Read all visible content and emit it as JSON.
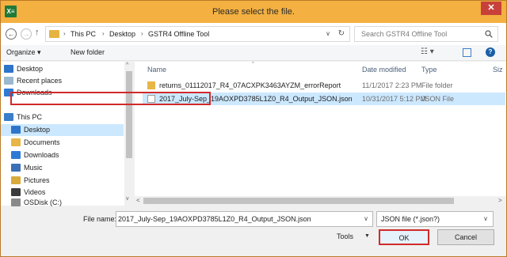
{
  "window": {
    "title": "Please select the file.",
    "app_icon": "X≡",
    "close_symbol": "✕"
  },
  "address_bar": {
    "back_symbol": "←",
    "forward_symbol": "→",
    "up_symbol": "↑",
    "breadcrumb": [
      "This PC",
      "Desktop",
      "GSTR4 Offline Tool"
    ],
    "separator": "›",
    "dropdown_symbol": "∨",
    "refresh_symbol": "↻",
    "search_placeholder": "Search GSTR4 Offline Tool"
  },
  "toolbar": {
    "organize_label": "Organize ▾",
    "new_folder_label": "New folder",
    "view_symbol": "☷ ▾",
    "help_symbol": "?"
  },
  "nav_pane": {
    "items": [
      {
        "label": "Desktop",
        "icon": "desktop-icon"
      },
      {
        "label": "Recent places",
        "icon": "recent-places-icon"
      },
      {
        "label": "Downloads",
        "icon": "downloads-icon"
      },
      {
        "label": "This PC",
        "icon": "computer-icon"
      },
      {
        "label": "Desktop",
        "icon": "desktop-folder-icon"
      },
      {
        "label": "Documents",
        "icon": "documents-folder-icon"
      },
      {
        "label": "Downloads",
        "icon": "downloads-folder-icon"
      },
      {
        "label": "Music",
        "icon": "music-folder-icon"
      },
      {
        "label": "Pictures",
        "icon": "pictures-folder-icon"
      },
      {
        "label": "Videos",
        "icon": "videos-folder-icon"
      },
      {
        "label": "OSDisk (C:)",
        "icon": "disk-icon"
      }
    ],
    "selected_index": 4,
    "scroll_up": "^",
    "scroll_down": "v"
  },
  "file_list": {
    "columns": {
      "name": "Name",
      "date": "Date modified",
      "type": "Type",
      "size": "Siz"
    },
    "sort_indicator": "^",
    "rows": [
      {
        "name": "returns_01112017_R4_07ACXPK3463AYZM_errorReport",
        "date": "11/1/2017 2:23 PM",
        "type": "File folder",
        "icon": "folder-icon"
      },
      {
        "name": "2017_July-Sep_19AOXPD3785L1Z0_R4_Output_JSON.json",
        "date": "10/31/2017 5:12 PM",
        "type": "JSON File",
        "icon": "json-file-icon"
      }
    ],
    "selected_index": 1,
    "hscroll_left": "<",
    "hscroll_right": ">"
  },
  "bottom": {
    "file_name_label": "File name:",
    "file_name_value": "2017_July-Sep_19AOXPD3785L1Z0_R4_Output_JSON.json",
    "dropdown_symbol": "∨",
    "filter_value": "JSON file (*.json?)",
    "tools_label": "Tools",
    "tools_drop": "▼",
    "ok_label": "OK",
    "cancel_label": "Cancel"
  },
  "colors": {
    "title_bar": "#f4b040",
    "close_button": "#c7413a",
    "highlight": "#d12a2a",
    "selection": "#cce8ff"
  }
}
